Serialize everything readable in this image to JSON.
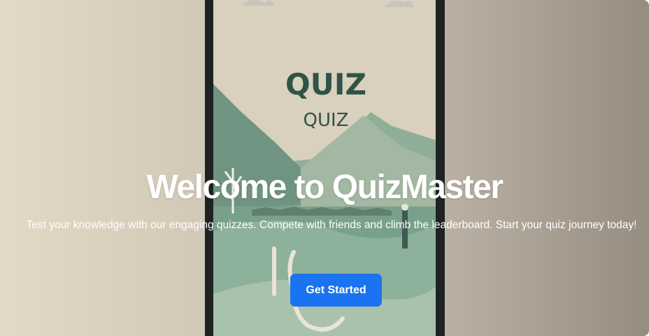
{
  "hero": {
    "title": "Welcome to QuizMaster",
    "subtitle": "Test your knowledge with our engaging quizzes. Compete with friends and climb the leaderboard. Start your quiz journey today!",
    "cta_label": "Get Started",
    "background_art": {
      "heading": "QUIZ",
      "subheading": "QUIZ"
    }
  },
  "colors": {
    "cta": "#1a73f0",
    "phone_frame": "#1e2322",
    "screen_bg": "#d9d0bd",
    "mountain": "#7e9e8a"
  }
}
